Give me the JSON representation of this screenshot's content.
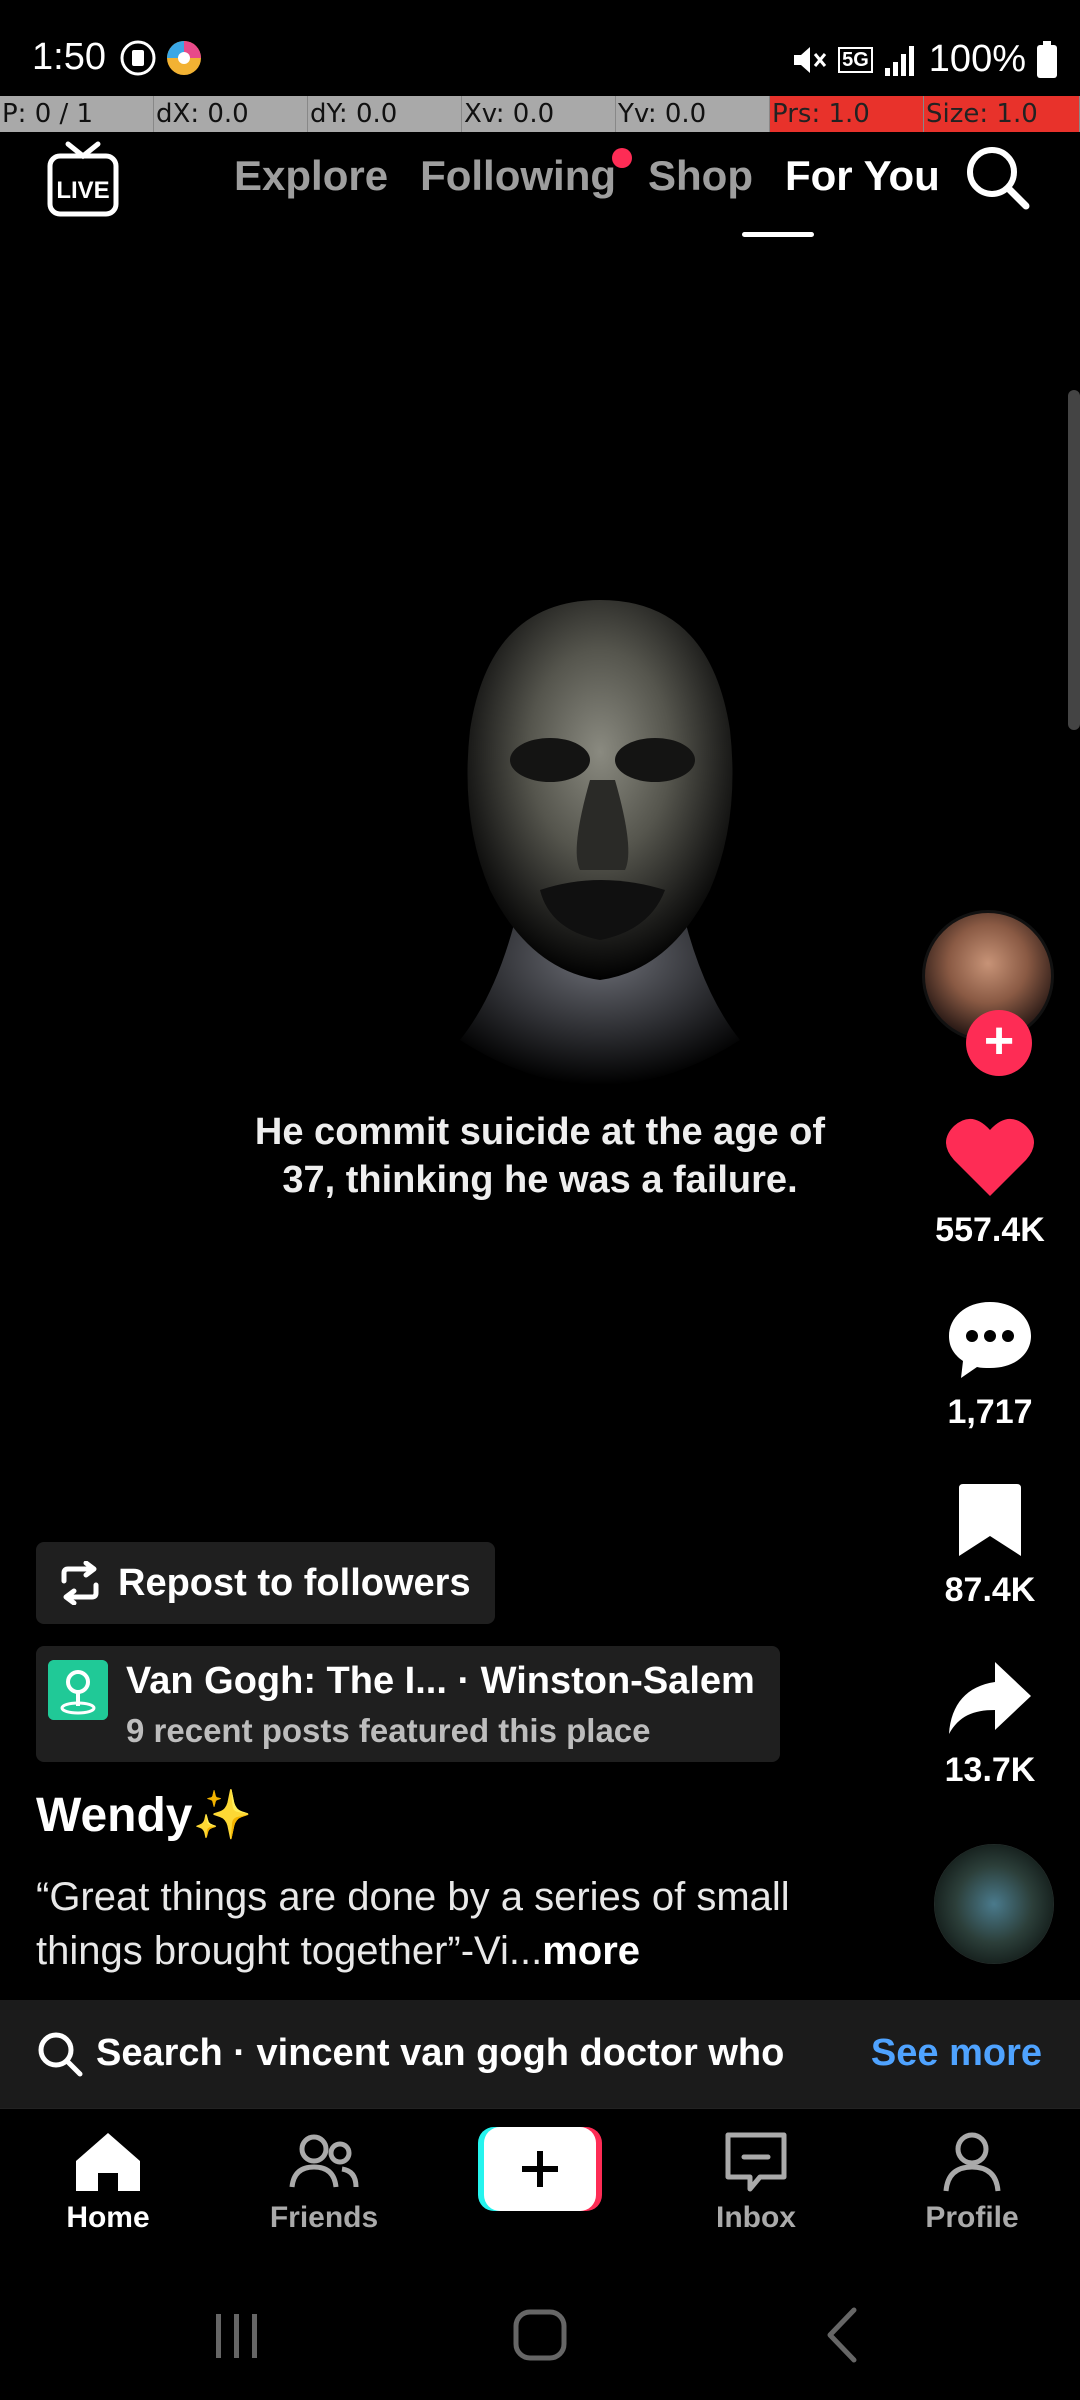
{
  "status_bar": {
    "time": "1:50",
    "battery": "100%",
    "network": "5G"
  },
  "pointer_bar": [
    "P: 0 / 1",
    "dX: 0.0",
    "dY: 0.0",
    "Xv: 0.0",
    "Yv: 0.0",
    "Prs: 1.0",
    "Size: 1.0"
  ],
  "top_nav": {
    "live_label": "LIVE",
    "tabs": [
      "Explore",
      "Following",
      "Shop",
      "For You"
    ],
    "active_tab": "For You"
  },
  "video": {
    "caption": "He commit suicide at the age of 37, thinking he was a failure."
  },
  "actions": {
    "likes": "557.4K",
    "comments": "1,717",
    "saves": "87.4K",
    "shares": "13.7K"
  },
  "post": {
    "repost_label": "Repost to followers",
    "place_title": "Van Gogh: The I...   · Winston-Salem",
    "place_sub": "9 recent posts featured this place",
    "username": "Wendy✨",
    "description": "“Great things are done by a series of small things brought together”-Vi...",
    "more_label": "more"
  },
  "search": {
    "text": "Search · vincent van gogh doctor who",
    "see_more": "See more"
  },
  "bottom_tabs": {
    "home": "Home",
    "friends": "Friends",
    "inbox": "Inbox",
    "profile": "Profile"
  },
  "colors": {
    "accent_red": "#fe2c55",
    "link_blue": "#4fa3ff",
    "place_green": "#20c997"
  }
}
